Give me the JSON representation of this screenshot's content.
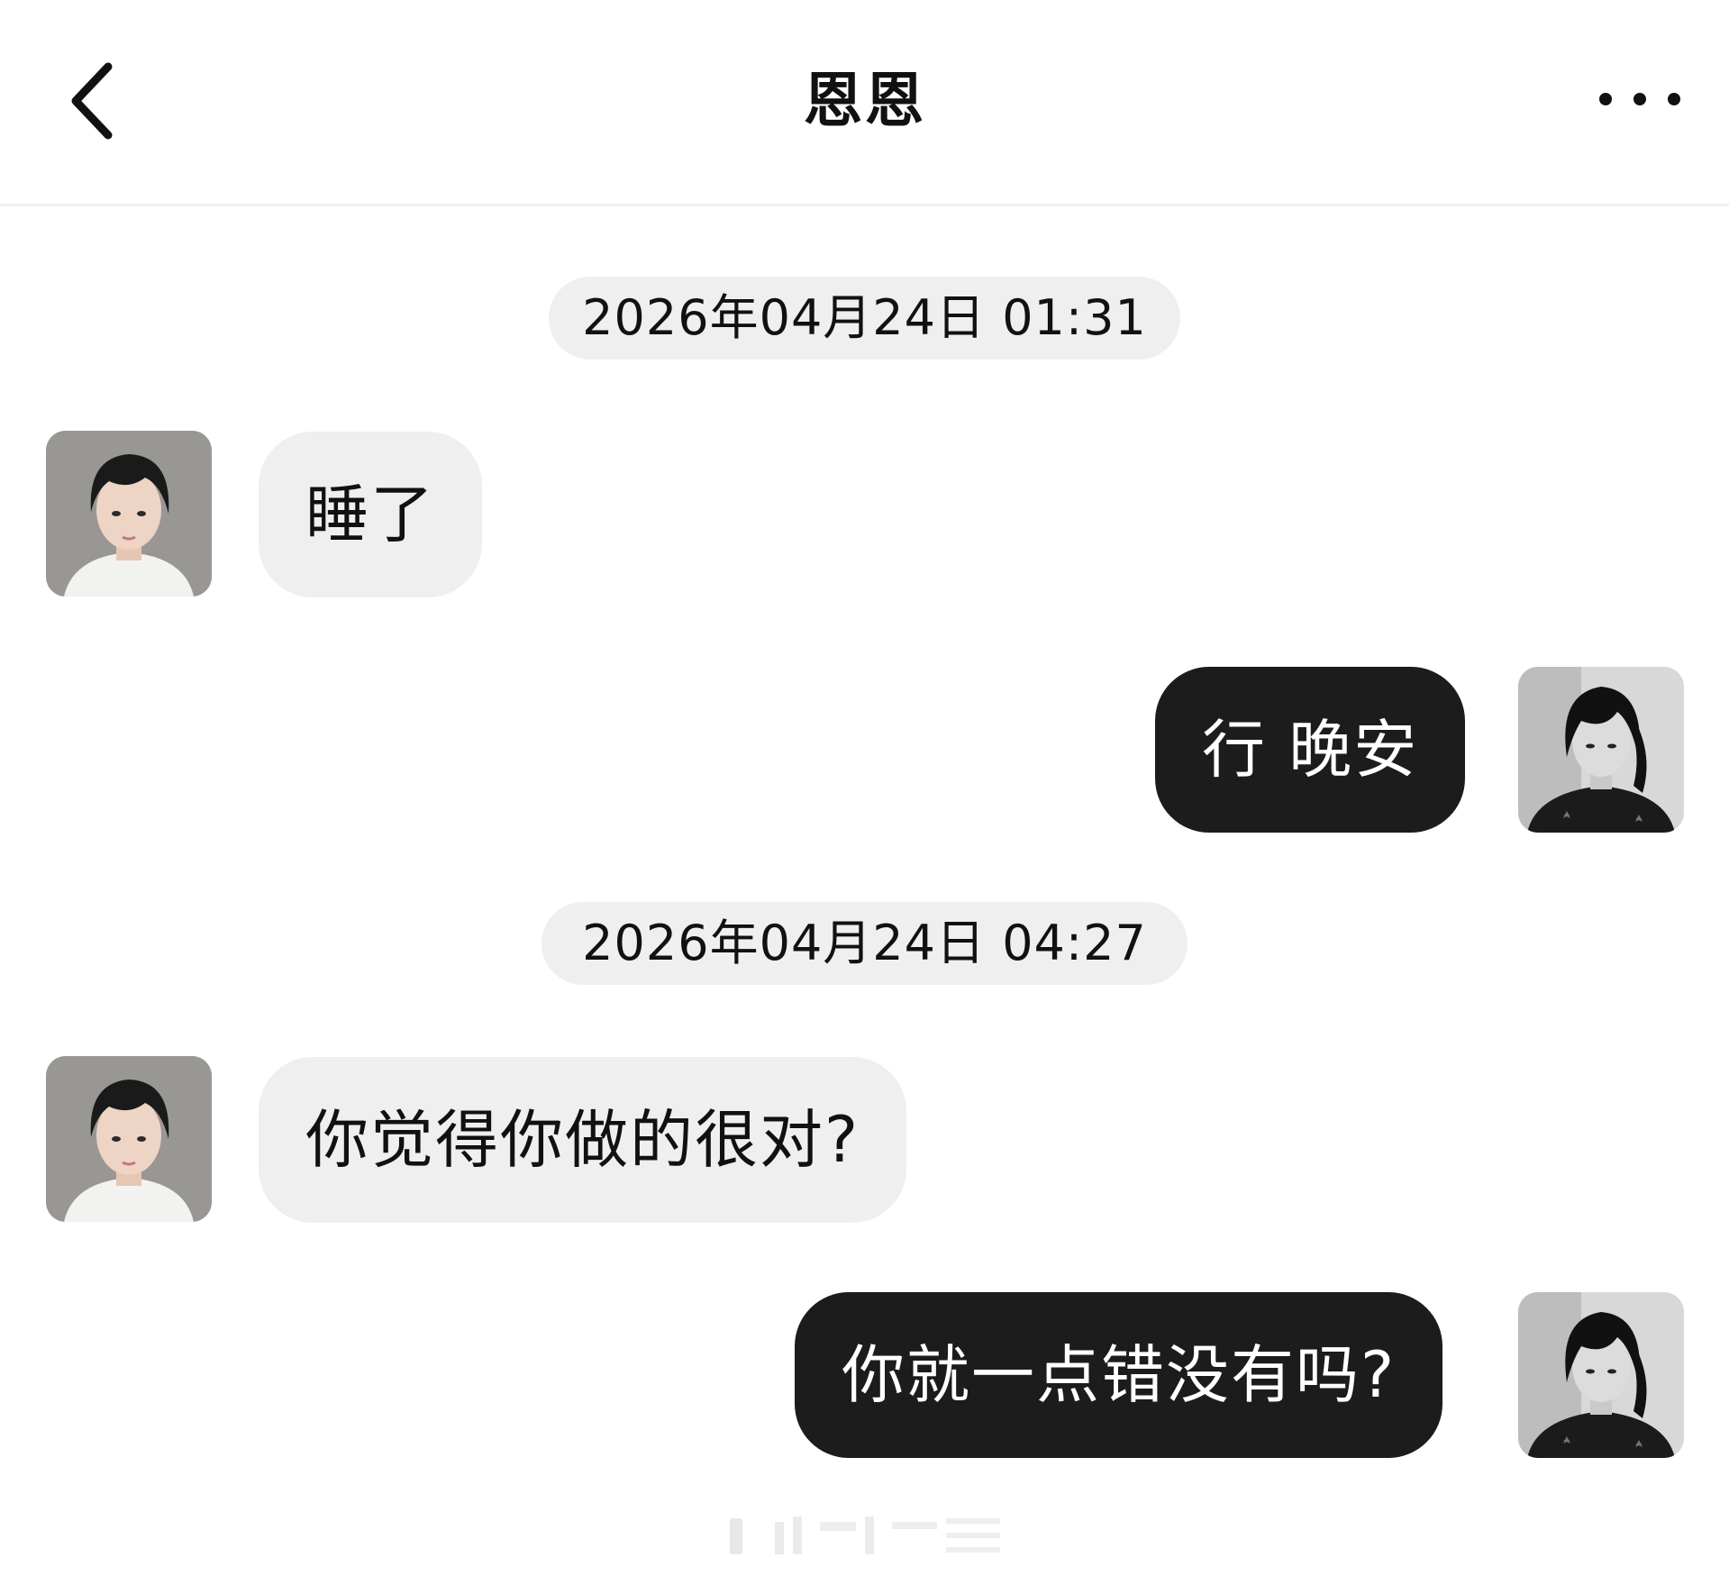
{
  "header": {
    "title": "恩恩"
  },
  "messages": [
    {
      "type": "timestamp",
      "text": "2026年04月24日 01:31"
    },
    {
      "type": "received",
      "text": "睡了"
    },
    {
      "type": "sent",
      "text": "行 晚安"
    },
    {
      "type": "timestamp",
      "text": "2026年04月24日 04:27"
    },
    {
      "type": "received",
      "text": "你觉得你做的很对?"
    },
    {
      "type": "sent",
      "text": "你就一点错没有吗?"
    }
  ],
  "icons": {
    "back": "chevron-left-icon",
    "more": "more-horizontal-icon"
  },
  "colors": {
    "received_bubble": "#efefef",
    "sent_bubble": "#1c1c1c",
    "timestamp_bg": "#efefef"
  }
}
